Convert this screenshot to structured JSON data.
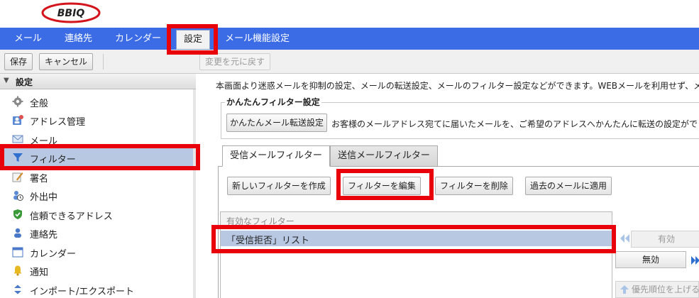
{
  "brand": {
    "logo_text": "BBIQ"
  },
  "nav": {
    "items": [
      {
        "label": "メール"
      },
      {
        "label": "連絡先"
      },
      {
        "label": "カレンダー"
      },
      {
        "label": "設定"
      },
      {
        "label": "メール機能設定"
      }
    ],
    "active": "設定"
  },
  "toolbar": {
    "save_label": "保存",
    "cancel_label": "キャンセル",
    "revert_label": "変更を元に戻す"
  },
  "sidebar": {
    "header": "設定",
    "items": [
      {
        "label": "全般",
        "icon": "gear-icon"
      },
      {
        "label": "アドレス管理",
        "icon": "address-book-icon"
      },
      {
        "label": "メール",
        "icon": "envelope-icon"
      },
      {
        "label": "フィルター",
        "icon": "filter-icon",
        "selected": true
      },
      {
        "label": "署名",
        "icon": "pen-icon"
      },
      {
        "label": "外出中",
        "icon": "clock-person-icon"
      },
      {
        "label": "信頼できるアドレス",
        "icon": "shield-check-icon"
      },
      {
        "label": "連絡先",
        "icon": "person-icon"
      },
      {
        "label": "カレンダー",
        "icon": "calendar-icon"
      },
      {
        "label": "通知",
        "icon": "bell-icon"
      },
      {
        "label": "インポート/エクスポート",
        "icon": "import-export-icon"
      }
    ]
  },
  "main": {
    "intro": "本画面より迷惑メールを抑制の設定、メールの転送設定、メールのフィルター設定などができます。WEBメールを利用せず、メ",
    "easy_filter": {
      "legend": "かんたんフィルター設定",
      "forward_button": "かんたんメール転送設定",
      "forward_desc": "お客様のメールアドレス宛てに届いたメールを、ご希望のアドレスへかんたんに転送の設定ができ"
    },
    "tabs": [
      {
        "label": "受信メールフィルター",
        "active": true
      },
      {
        "label": "送信メールフィルター",
        "active": false
      }
    ],
    "filter_buttons": {
      "new": "新しいフィルターを作成",
      "edit": "フィルターを編集",
      "delete": "フィルターを削除",
      "apply": "過去のメールに適用"
    },
    "list": {
      "header": "有効なフィルター",
      "rows": [
        "「受信拒否」リスト"
      ]
    },
    "side_buttons": {
      "enable": "有効",
      "disable": "無効",
      "priority_up": "優先順位を上げる"
    }
  },
  "colors": {
    "nav_bg": "#3b6ce6",
    "highlight": "#e8000b",
    "selected_row": "#b8c8e2",
    "logo_red": "#d4141c"
  }
}
